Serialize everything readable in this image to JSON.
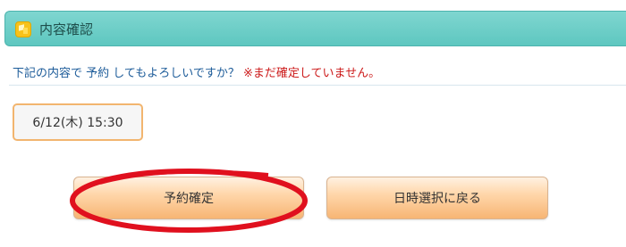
{
  "header": {
    "icon": "box-icon",
    "title": "内容確認"
  },
  "message": {
    "question": "下記の内容で 予約 してもよろしいですか？",
    "warning": "※まだ確定していません。"
  },
  "reservation": {
    "datetime": "6/12(木) 15:30"
  },
  "buttons": {
    "confirm_label": "予約確定",
    "back_label": "日時選択に戻る"
  },
  "colors": {
    "header_bg": "#6fcfc8",
    "question_text": "#1c5b99",
    "warning_text": "#cc1a1a",
    "box_border": "#f2b56f",
    "button_gradient_bottom": "#f7b574",
    "annotation": "#e0101e"
  }
}
